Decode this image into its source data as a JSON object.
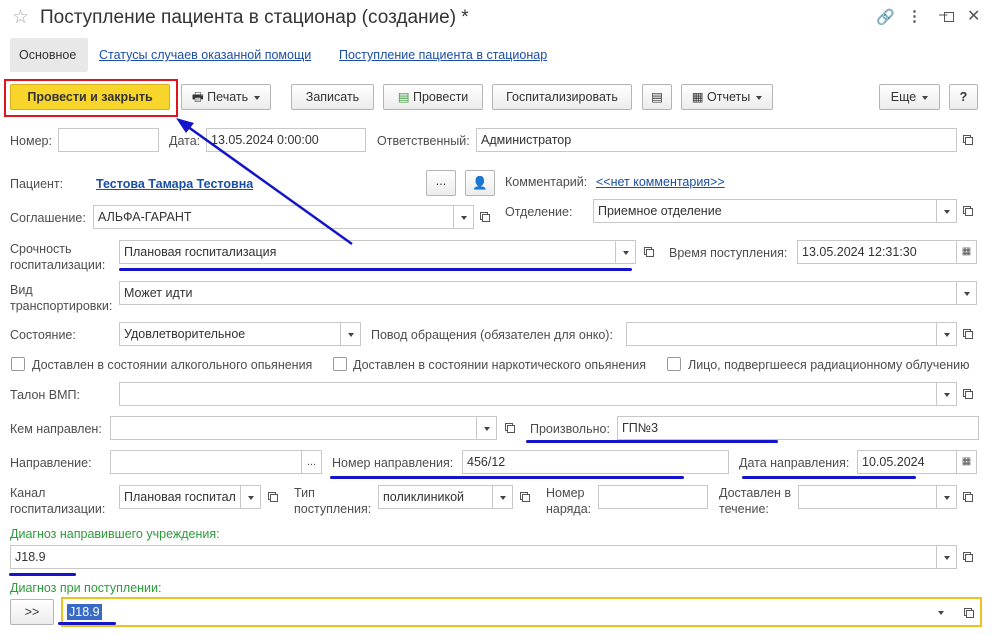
{
  "window": {
    "title": "Поступление пациента в стационар (создание) *"
  },
  "tabs": [
    {
      "label": "Основное"
    },
    {
      "label": "Статусы случаев оказанной помощи"
    },
    {
      "label": "Поступление пациента в стационар"
    }
  ],
  "toolbar": {
    "post_close": "Провести и закрыть",
    "print": "Печать",
    "save": "Записать",
    "post": "Провести",
    "hospitalize": "Госпитализировать",
    "reports": "Отчеты",
    "more": "Еще",
    "help": "?"
  },
  "form": {
    "number": {
      "label": "Номер:",
      "value": ""
    },
    "date": {
      "label": "Дата:",
      "value": "13.05.2024  0:00:00"
    },
    "responsible": {
      "label": "Ответственный:",
      "value": "Администратор"
    },
    "patient": {
      "label": "Пациент:",
      "value": "Тестова Тамара Тестовна",
      "ellipsis": "..."
    },
    "comment": {
      "label": "Комментарий:",
      "value": "<<нет комментария>>"
    },
    "agreement": {
      "label": "Соглашение:",
      "value": "АЛЬФА-ГАРАНТ"
    },
    "department": {
      "label": "Отделение:",
      "value": "Приемное отделение"
    },
    "urgency": {
      "label1": "Срочность",
      "label2": "госпитализации:",
      "value": "Плановая госпитализация"
    },
    "arrival_time": {
      "label": "Время поступления:",
      "value": "13.05.2024 12:31:30"
    },
    "transport": {
      "label1": "Вид",
      "label2": "транспортировки:",
      "value": "Может идти"
    },
    "condition": {
      "label": "Состояние:",
      "value": "Удовлетворительное"
    },
    "reason": {
      "label": "Повод обращения (обязателен для онко):",
      "value": ""
    },
    "checks": [
      {
        "label": "Доставлен в состоянии алкогольного опьянения",
        "checked": false
      },
      {
        "label": "Доставлен в состоянии наркотического опьянения",
        "checked": false
      },
      {
        "label": "Лицо, подвергшееся радиационному облучению",
        "checked": false
      }
    ],
    "vmp": {
      "label": "Талон ВМП:",
      "value": ""
    },
    "referred_by": {
      "label": "Кем направлен:",
      "value": ""
    },
    "arbitrary": {
      "label": "Произвольно:",
      "value": "ГП№3"
    },
    "referral": {
      "label": "Направление:",
      "value": "",
      "ellipsis": "..."
    },
    "referral_number": {
      "label": "Номер направления:",
      "value": "456/12"
    },
    "referral_date": {
      "label": "Дата направления:",
      "value": "10.05.2024"
    },
    "channel": {
      "label1": "Канал",
      "label2": "госпитализации:",
      "value": "Плановая госпитал"
    },
    "admission_type": {
      "label1": "Тип",
      "label2": "поступления:",
      "value": "поликлиникой"
    },
    "order_number": {
      "label1": "Номер",
      "label2": "наряда:",
      "value": ""
    },
    "delivered_within": {
      "label1": "Доставлен в",
      "label2": "течение:",
      "value": ""
    },
    "referring_diagnosis": {
      "label": "Диагноз направившего учреждения:",
      "value": "J18.9"
    },
    "admission_diagnosis": {
      "label": "Диагноз при поступлении:",
      "value": "J18.9",
      "copy_button": ">>"
    }
  },
  "colors": {
    "accent_yellow": "#f7d52b",
    "highlight_red": "#e0141e",
    "annotation_blue": "#1414c8",
    "link": "#1b4ea6",
    "green_label": "#2b9a3a",
    "focus_border": "#f0c020"
  }
}
